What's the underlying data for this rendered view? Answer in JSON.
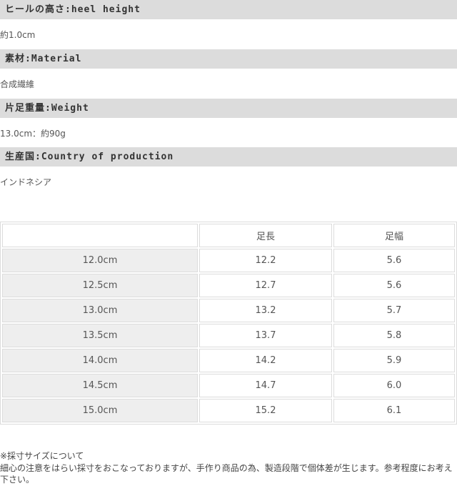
{
  "specs": {
    "heel_height": {
      "label": "ヒールの高さ:heel height",
      "value": "約1.0cm"
    },
    "material": {
      "label": "素材:Material",
      "value": "合成繊維"
    },
    "weight": {
      "label": "片足重量:Weight",
      "value": "13.0cm：約90g"
    },
    "country": {
      "label": "生産国:Country of production",
      "value": "インドネシア"
    }
  },
  "size_table": {
    "headers": [
      "",
      "足長",
      "足幅"
    ],
    "rows": [
      [
        "12.0cm",
        "12.2",
        "5.6"
      ],
      [
        "12.5cm",
        "12.7",
        "5.6"
      ],
      [
        "13.0cm",
        "13.2",
        "5.7"
      ],
      [
        "13.5cm",
        "13.7",
        "5.8"
      ],
      [
        "14.0cm",
        "14.2",
        "5.9"
      ],
      [
        "14.5cm",
        "14.7",
        "6.0"
      ],
      [
        "15.0cm",
        "15.2",
        "6.1"
      ]
    ]
  },
  "notes": {
    "line1": "※採寸サイズについて",
    "line2": "細心の注意をはらい採寸をおこなっておりますが、手作り商品の為、製造段階で個体差が生じます。参考程度にお考え下さい。"
  }
}
